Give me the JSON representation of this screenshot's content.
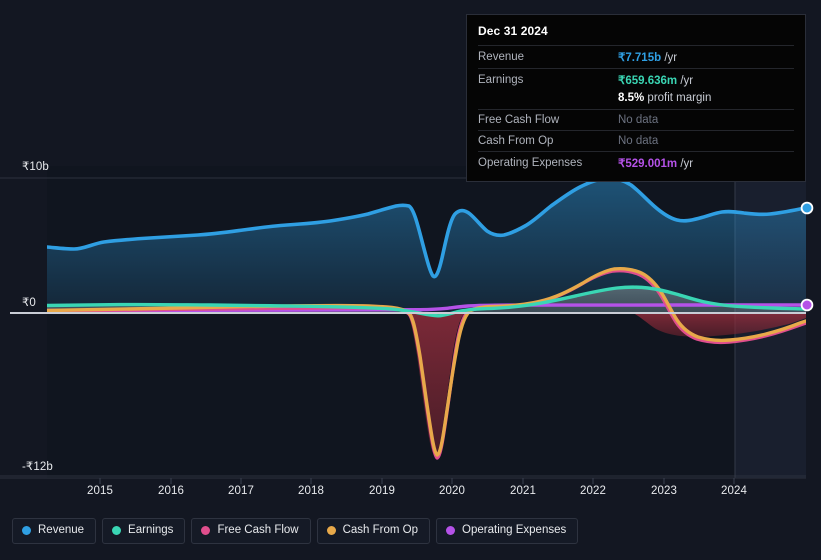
{
  "chart_data": {
    "type": "area",
    "title": "",
    "xlabel": "",
    "ylabel": "",
    "currency_symbol": "₹",
    "x_tick_labels": [
      "2015",
      "2016",
      "2017",
      "2018",
      "2019",
      "2020",
      "2021",
      "2022",
      "2023",
      "2024"
    ],
    "y_tick_labels": [
      "₹10b",
      "₹0",
      "-₹12b"
    ],
    "ylim": [
      -12,
      10
    ],
    "xlim": [
      2014.25,
      2025.1
    ],
    "grid": true,
    "legend_position": "bottom-left",
    "series": [
      {
        "name": "Revenue",
        "color": "#2f9fe3",
        "x": [
          2014.25,
          2014.6,
          2015.0,
          2015.5,
          2016.0,
          2016.5,
          2017.0,
          2017.5,
          2018.0,
          2018.5,
          2019.0,
          2019.35,
          2019.6,
          2019.75,
          2019.95,
          2020.1,
          2020.4,
          2020.8,
          2021.2,
          2021.6,
          2022.0,
          2022.4,
          2022.7,
          2023.0,
          2023.4,
          2023.8,
          2024.2,
          2024.6,
          2025.0
        ],
        "values": [
          4.85,
          4.8,
          5.05,
          5.15,
          5.2,
          5.25,
          5.3,
          5.4,
          5.55,
          5.8,
          6.1,
          6.15,
          3.0,
          4.8,
          6.2,
          6.1,
          5.8,
          5.95,
          6.6,
          7.6,
          8.6,
          9.25,
          9.2,
          8.3,
          7.8,
          8.0,
          7.85,
          7.75,
          7.715
        ]
      },
      {
        "name": "Earnings",
        "color": "#3ad6b4",
        "x": [
          2014.25,
          2015.0,
          2016.0,
          2017.0,
          2018.0,
          2019.0,
          2019.5,
          2019.75,
          2020.0,
          2020.5,
          2021.0,
          2021.5,
          2022.0,
          2022.4,
          2022.8,
          2023.2,
          2023.6,
          2024.0,
          2024.5,
          2025.0
        ],
        "values": [
          0.55,
          0.6,
          0.62,
          0.6,
          0.58,
          0.5,
          0.2,
          -0.1,
          0.35,
          0.45,
          0.7,
          1.0,
          1.4,
          1.65,
          1.55,
          1.15,
          0.9,
          0.78,
          0.7,
          0.66
        ]
      },
      {
        "name": "Free Cash Flow",
        "color": "#e04e8d",
        "x": [
          2014.25,
          2015.0,
          2016.0,
          2017.0,
          2018.0,
          2018.8,
          2019.1,
          2019.35,
          2019.6,
          2019.85,
          2020.1,
          2020.4,
          2020.8,
          2021.3,
          2021.8,
          2022.2,
          2022.5,
          2022.8,
          2023.1,
          2023.5,
          2024.0,
          2024.5,
          2025.0
        ],
        "values": [
          0.15,
          0.2,
          0.3,
          0.45,
          0.45,
          0.35,
          -0.4,
          -7.8,
          -10.6,
          -6.0,
          -0.3,
          0.25,
          0.45,
          0.9,
          2.3,
          3.1,
          3.15,
          2.3,
          -0.3,
          -1.6,
          -1.85,
          -1.6,
          -1.05
        ]
      },
      {
        "name": "Cash From Op",
        "color": "#e8a94a",
        "x": [
          2014.25,
          2015.0,
          2016.0,
          2017.0,
          2018.0,
          2018.8,
          2019.2,
          2019.45,
          2019.7,
          2019.9,
          2020.15,
          2020.5,
          2020.9,
          2021.4,
          2021.9,
          2022.25,
          2022.55,
          2022.85,
          2023.15,
          2023.55,
          2024.0,
          2024.5,
          2025.0
        ],
        "values": [
          0.2,
          0.28,
          0.4,
          0.6,
          0.62,
          0.5,
          -0.2,
          -7.2,
          -10.4,
          -5.5,
          -0.1,
          0.35,
          0.55,
          1.0,
          2.45,
          3.3,
          3.3,
          2.5,
          -0.2,
          -1.35,
          -1.5,
          -1.3,
          -0.72
        ]
      },
      {
        "name": "Operating Expenses",
        "color": "#b552e8",
        "x": [
          2014.25,
          2018.0,
          2019.5,
          2019.9,
          2020.2,
          2021.0,
          2022.0,
          2023.0,
          2024.0,
          2025.0
        ],
        "values": [
          0.18,
          0.2,
          0.22,
          0.3,
          0.5,
          0.5,
          0.52,
          0.53,
          0.53,
          0.529
        ]
      }
    ],
    "endpoint_markers": [
      {
        "series": "Revenue",
        "value": 7.715,
        "color": "#2f9fe3"
      },
      {
        "series": "Operating Expenses",
        "value": 0.529,
        "color": "#b552e8"
      }
    ]
  },
  "tooltip": {
    "title": "Dec 31 2024",
    "rows": [
      {
        "label": "Revenue",
        "value": "₹7.715b",
        "unit": "/yr",
        "color": "#2f9fe3",
        "no_data": false
      },
      {
        "label": "Earnings",
        "value": "₹659.636m",
        "unit": "/yr",
        "color": "#3ad6b4",
        "no_data": false
      },
      {
        "label": "Free Cash Flow",
        "value": "No data",
        "unit": "",
        "color": "#6c7280",
        "no_data": true
      },
      {
        "label": "Cash From Op",
        "value": "No data",
        "unit": "",
        "color": "#6c7280",
        "no_data": true
      },
      {
        "label": "Operating Expenses",
        "value": "₹529.001m",
        "unit": "/yr",
        "color": "#b552e8",
        "no_data": false
      }
    ],
    "margin": {
      "value": "8.5%",
      "text": "profit margin"
    }
  },
  "legend": {
    "items": [
      {
        "label": "Revenue",
        "color": "#2f9fe3"
      },
      {
        "label": "Earnings",
        "color": "#3ad6b4"
      },
      {
        "label": "Free Cash Flow",
        "color": "#e04e8d"
      },
      {
        "label": "Cash From Op",
        "color": "#e8a94a"
      },
      {
        "label": "Operating Expenses",
        "color": "#b552e8"
      }
    ]
  },
  "axes": {
    "y_ticks": [
      {
        "label": "₹10b",
        "value": 10
      },
      {
        "label": "₹0",
        "value": 0
      },
      {
        "label": "-₹12b",
        "value": -12
      }
    ],
    "x_ticks": [
      {
        "label": "2015",
        "value": 2015
      },
      {
        "label": "2016",
        "value": 2016
      },
      {
        "label": "2017",
        "value": 2017
      },
      {
        "label": "2018",
        "value": 2018
      },
      {
        "label": "2019",
        "value": 2019
      },
      {
        "label": "2020",
        "value": 2020
      },
      {
        "label": "2021",
        "value": 2021
      },
      {
        "label": "2022",
        "value": 2022
      },
      {
        "label": "2023",
        "value": 2023
      },
      {
        "label": "2024",
        "value": 2024
      }
    ]
  },
  "colors": {
    "background": "#131722",
    "plot_background": "#10151f",
    "grid": "#2c313d",
    "zero_line": "#c8ccd4",
    "forecast_band": "#1a2030"
  }
}
